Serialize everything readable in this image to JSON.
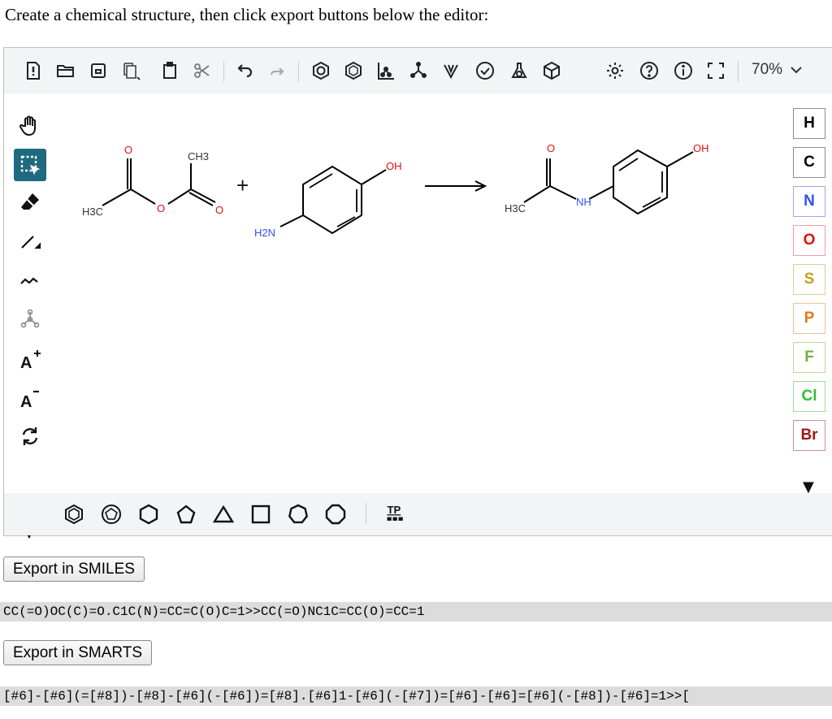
{
  "instruction": "Create a chemical structure, then click export buttons below the editor:",
  "toolbar": {
    "zoom": "70%",
    "icons": [
      "new-file-icon",
      "open-folder-icon",
      "save-icon",
      "copy-icon",
      "paste-icon",
      "cut-icon",
      "undo-icon",
      "redo-icon",
      "aromatize-icon",
      "dearomatize-icon",
      "layout-icon",
      "clean-icon",
      "stereo-icon",
      "check-icon",
      "analyze-icon",
      "3d-view-icon",
      "settings-icon",
      "help-icon",
      "info-icon",
      "fullscreen-icon"
    ]
  },
  "left_tools": [
    "hand-tool-icon",
    "select-tool-icon",
    "eraser-icon",
    "bond-tool-icon",
    "chain-tool-icon",
    "template-tool-icon",
    "charge-plus-icon",
    "charge-minus-icon",
    "rotate-tool-icon"
  ],
  "atoms": [
    {
      "symbol": "H",
      "color": "#000000"
    },
    {
      "symbol": "C",
      "color": "#000000"
    },
    {
      "symbol": "N",
      "color": "#3050F8"
    },
    {
      "symbol": "O",
      "color": "#E01010"
    },
    {
      "symbol": "S",
      "color": "#C0A020"
    },
    {
      "symbol": "P",
      "color": "#E07818"
    },
    {
      "symbol": "F",
      "color": "#70B040"
    },
    {
      "symbol": "Cl",
      "color": "#30C030"
    },
    {
      "symbol": "Br",
      "color": "#A01818"
    }
  ],
  "canvas": {
    "labels": {
      "h3c_1": "H3C",
      "o_1": "O",
      "ch3": "CH3",
      "o_2": "O",
      "o_3": "O",
      "plus": "+",
      "oh_1": "OH",
      "h2n": "H2N",
      "o_4": "O",
      "h3c_2": "H3C",
      "nh": "NH",
      "oh_2": "OH"
    }
  },
  "bottom_toolbar": {
    "icons": [
      "benzene-icon",
      "cyclopentadiene-icon",
      "cyclohexane-icon",
      "cyclopentane-icon",
      "cyclopropane-icon",
      "cyclobutane-icon",
      "cycloheptane-icon",
      "cyclooctane-icon",
      "template-library-icon"
    ],
    "tp_label": "TP"
  },
  "exports": {
    "smiles_button": "Export in SMILES",
    "smiles_output": "CC(=O)OC(C)=O.C1C(N)=CC=C(O)C=1>>CC(=O)NC1C=CC(O)=CC=1",
    "smarts_button": "Export in SMARTS",
    "smarts_output": "[#6]-[#6](=[#8])-[#8]-[#6](-[#6])=[#8].[#6]1-[#6](-[#7])=[#6]-[#6]=[#6](-[#8])-[#6]=1>>["
  }
}
